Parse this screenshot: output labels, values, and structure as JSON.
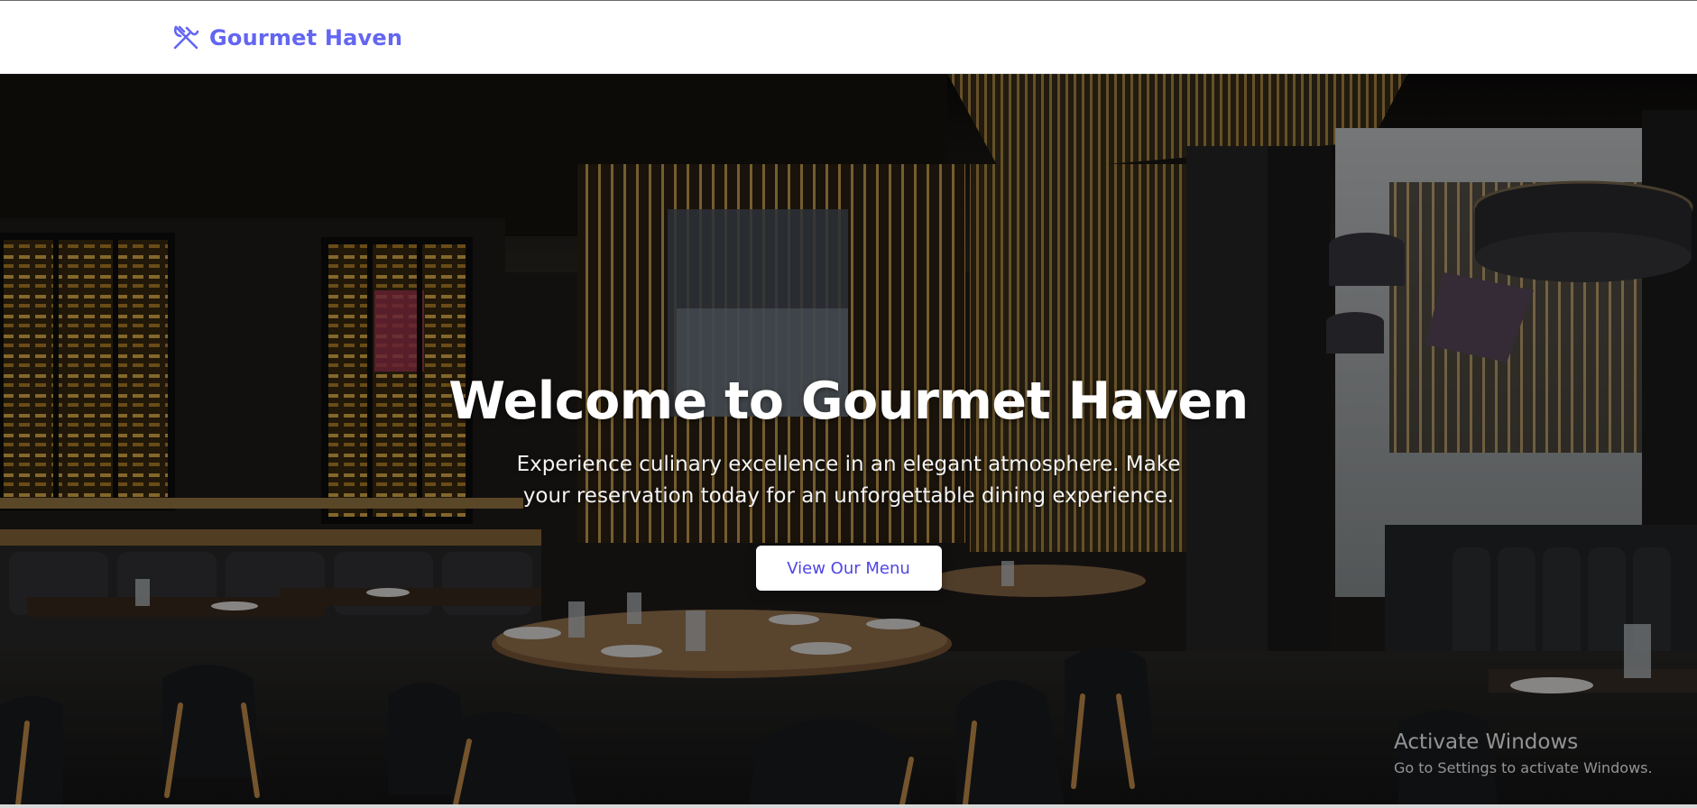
{
  "navbar": {
    "brand_name": "Gourmet Haven",
    "brand_icon": "utensils-crossed-icon",
    "brand_color": "#6366f1"
  },
  "hero": {
    "title": "Welcome to Gourmet Haven",
    "subtitle": "Experience culinary excellence in an elegant atmosphere. Make your reservation today for an unforgettable dining experience.",
    "cta_label": "View Our Menu",
    "cta_color": "#4f46e5",
    "background_image": "restaurant-interior-photo"
  },
  "watermark": {
    "title": "Activate Windows",
    "subtitle": "Go to Settings to activate Windows."
  }
}
